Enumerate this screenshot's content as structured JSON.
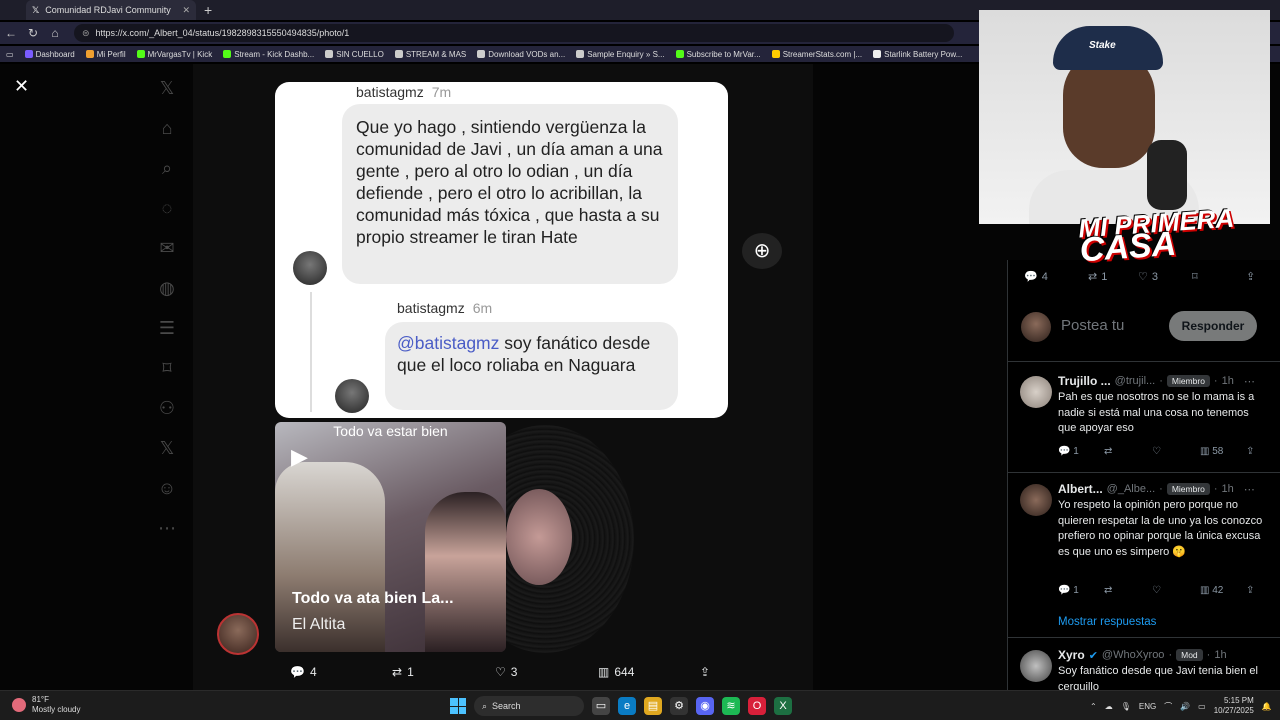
{
  "browser": {
    "tab_title": "Comunidad RDJavi Community",
    "tab_close": "✕",
    "new_tab": "+",
    "url": "https://x.com/_Albert_04/status/1982898315550494835/photo/1",
    "bookmarks": [
      {
        "label": "Dashboard",
        "color": "#7a5cff"
      },
      {
        "label": "Mi Perfil",
        "color": "#f0a030"
      },
      {
        "label": "MrVargasTv | Kick",
        "color": "#53fc18"
      },
      {
        "label": "Stream - Kick Dashb...",
        "color": "#53fc18"
      },
      {
        "label": "SIN CUELLO",
        "color": "#cccccc"
      },
      {
        "label": "STREAM & MAS",
        "color": "#cccccc"
      },
      {
        "label": "Download VODs an...",
        "color": "#cccccc"
      },
      {
        "label": "Sample Enquiry » S...",
        "color": "#cccccc"
      },
      {
        "label": "Subscribe to MrVar...",
        "color": "#53fc18"
      },
      {
        "label": "StreamerStats.com |...",
        "color": "#ffcc00"
      },
      {
        "label": "Starlink Battery Pow...",
        "color": "#eeeeee"
      }
    ]
  },
  "viewer": {
    "close": "✕",
    "zoom": "⊕"
  },
  "screenshot": {
    "user1": "batistagmz",
    "time1": "7m",
    "message1": "Que yo hago , sintiendo vergüenza la comunidad de Javi , un día aman a una gente , pero al otro lo odian , un día defiende , pero el otro lo acribillan, la comunidad más tóxica , que hasta a su propio streamer le tiran Hate",
    "user2": "batistagmz",
    "time2": "6m",
    "mention": "@batistagmz",
    "message2": " soy fanático desde que el loco roliaba en Naguara"
  },
  "music": {
    "header": "Todo va estar bien",
    "title": "Todo va ata bien La...",
    "artist": "El Altita"
  },
  "post_actions": {
    "replies": "4",
    "reposts": "1",
    "likes": "3",
    "views": "644"
  },
  "panel": {
    "actions": {
      "replies": "4",
      "reposts": "1",
      "likes": "3"
    },
    "composer_placeholder": "Postea tu",
    "reply_button": "Responder",
    "replies": [
      {
        "name": "Trujillo ...",
        "handle": "@trujil...",
        "badge": "Miembro",
        "time": "1h",
        "text": "Pah es que nosotros no se lo mama is a nadie si está mal una cosa no tenemos que apoyar eso",
        "replies": "1",
        "likes": "",
        "views": "58"
      },
      {
        "name": "Albert...",
        "handle": "@_Albe...",
        "badge": "Miembro",
        "time": "1h",
        "text": "Yo respeto la opinión pero porque no quieren respetar la de uno ya los conozco prefiero no opinar porque la única excusa es que uno es simpero 🤫",
        "replies": "1",
        "likes": "",
        "views": "42"
      },
      {
        "name": "Xyro",
        "handle": "@WhoXyroo",
        "badge": "Mod",
        "time": "1h",
        "text": "Soy fanático desde que Javi tenia bien el cerquillo"
      }
    ],
    "show_more": "Mostrar respuestas"
  },
  "overlay": {
    "logo_line1": "MI PRIMERA",
    "logo_line2": "CASA",
    "cap_text": "Stake"
  },
  "taskbar": {
    "temp": "81°F",
    "weather": "Mostly cloudy",
    "search": "Search",
    "lang": "ENG",
    "time": "5:15 PM",
    "date": "10/27/2025"
  }
}
